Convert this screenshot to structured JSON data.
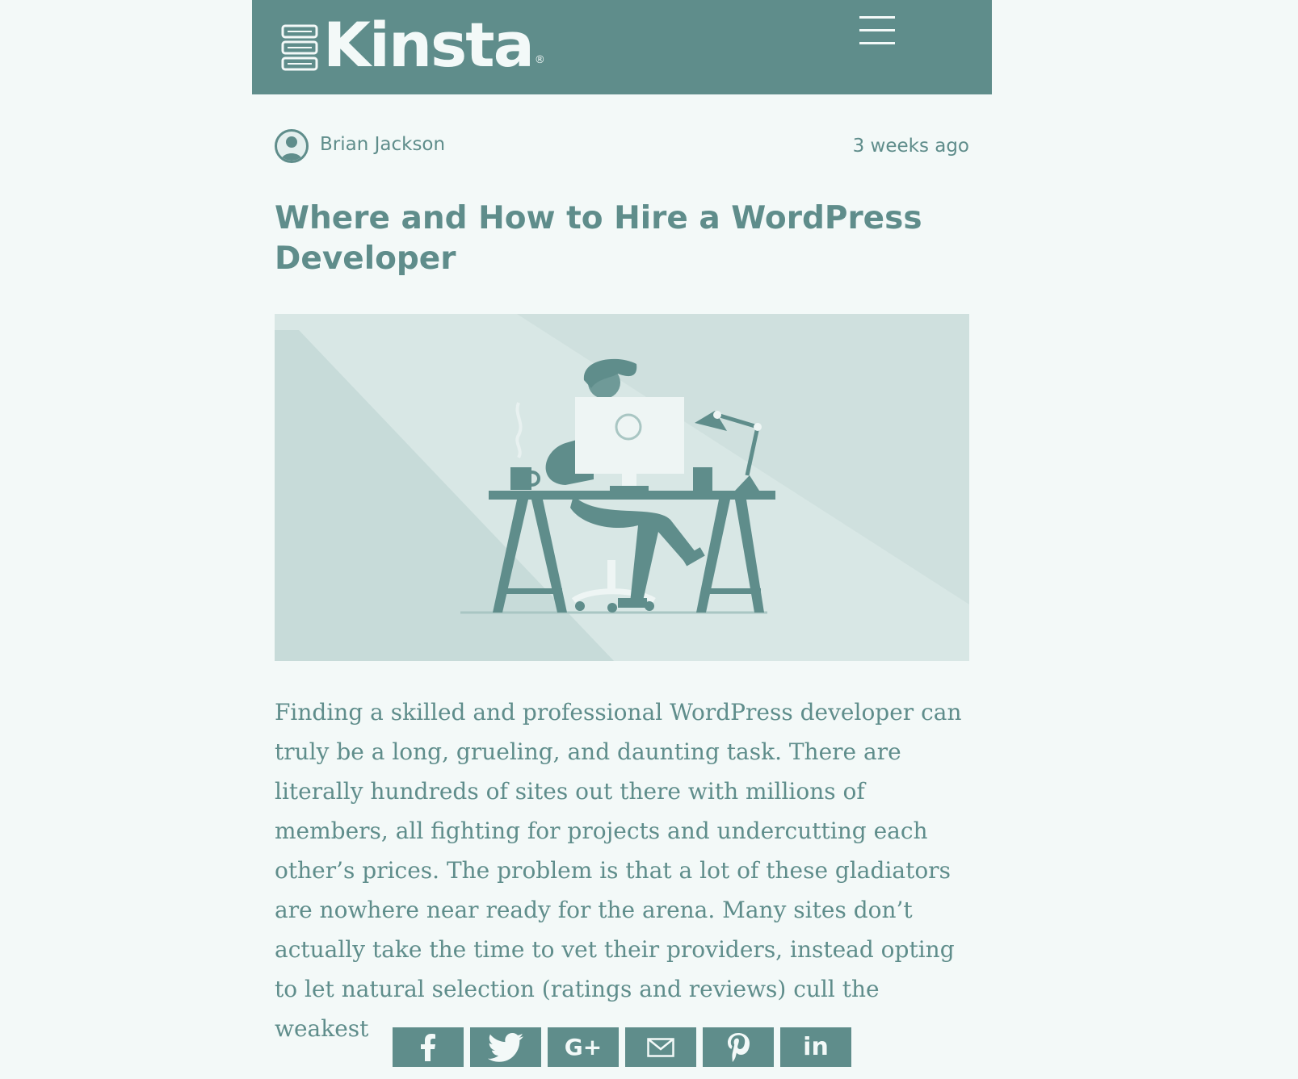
{
  "header": {
    "logo_text": "Kinsta",
    "logo_mark": "®",
    "menu_icon": "hamburger-menu-icon"
  },
  "post": {
    "author": "Brian Jackson",
    "date": "3 weeks ago",
    "title": "Where and How to Hire a WordPress Developer",
    "hero_image": "illustration of a developer at a desk with a WordPress monitor and desk lamp",
    "excerpt": "Finding a skilled and professional WordPress developer can truly be a long, grueling, and daunting task. There are literally hundreds of sites out there with millions of members, all fighting for projects and undercutting each other’s prices. The problem is that a lot of these gladiators are nowhere near ready for the arena. Many sites don’t actually take the time to vet their providers, instead opting to let natural selection (ratings and reviews) cull the weakest"
  },
  "share": {
    "buttons": [
      {
        "icon": "facebook-icon"
      },
      {
        "icon": "twitter-icon"
      },
      {
        "icon": "google-plus-icon",
        "label": "G+"
      },
      {
        "icon": "email-icon"
      },
      {
        "icon": "pinterest-icon"
      },
      {
        "icon": "linkedin-icon",
        "label": "in"
      }
    ]
  },
  "colors": {
    "accent": "#5f8d8b",
    "background": "#f3f9f8",
    "hero_background": "#cfe0de"
  }
}
